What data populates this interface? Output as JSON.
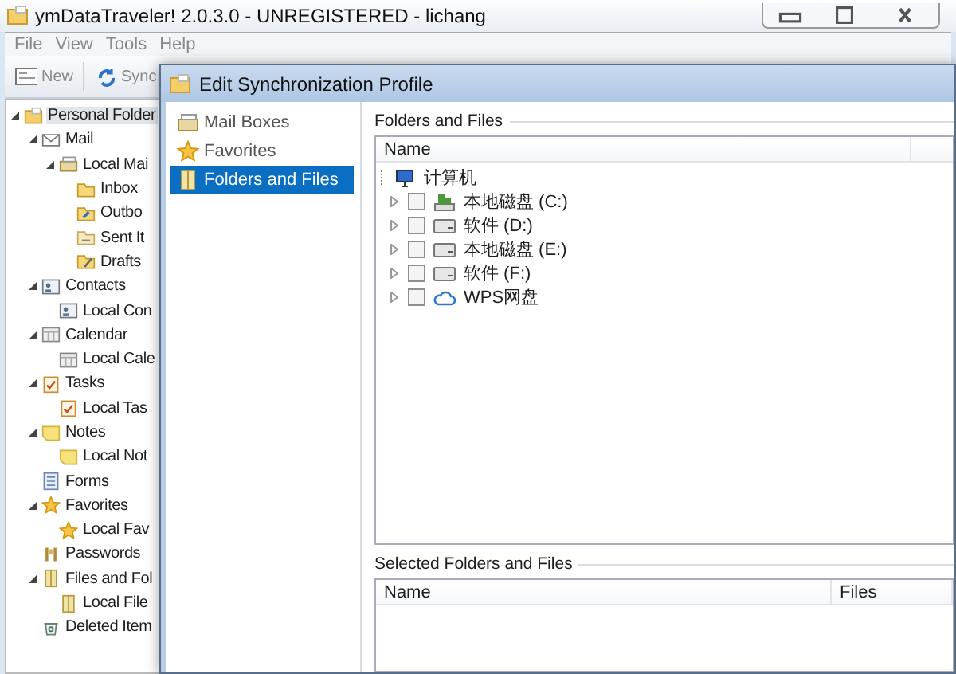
{
  "window": {
    "title": "ymDataTraveler! 2.0.3.0 - UNREGISTERED - lichang"
  },
  "menu": [
    "File",
    "View",
    "Tools",
    "Help"
  ],
  "toolbar": [
    {
      "label": "New",
      "kind": "new"
    },
    {
      "label": "Sync",
      "kind": "sync"
    }
  ],
  "tree": {
    "items": [
      {
        "label": "Personal Folder",
        "kind": "root",
        "expanded": true,
        "selected": true,
        "children": [
          {
            "label": "Mail",
            "kind": "mail",
            "expanded": true,
            "selected": false,
            "children": [
              {
                "label": "Local Mai",
                "kind": "mailbox",
                "expanded": true,
                "selected": false,
                "children": [
                  {
                    "label": "Inbox",
                    "kind": "folder",
                    "selected": false
                  },
                  {
                    "label": "Outbo",
                    "kind": "outbox",
                    "selected": false
                  },
                  {
                    "label": "Sent It",
                    "kind": "sent",
                    "selected": false
                  },
                  {
                    "label": "Drafts",
                    "kind": "drafts",
                    "selected": false
                  }
                ]
              }
            ]
          },
          {
            "label": "Contacts",
            "kind": "contacts",
            "expanded": true,
            "selected": false,
            "children": [
              {
                "label": "Local Con",
                "kind": "contacts",
                "selected": false
              }
            ]
          },
          {
            "label": "Calendar",
            "kind": "calendar",
            "expanded": true,
            "selected": false,
            "children": [
              {
                "label": "Local Cale",
                "kind": "calendar",
                "selected": false
              }
            ]
          },
          {
            "label": "Tasks",
            "kind": "tasks",
            "expanded": true,
            "selected": false,
            "children": [
              {
                "label": "Local Tas",
                "kind": "tasks",
                "selected": false
              }
            ]
          },
          {
            "label": "Notes",
            "kind": "notes",
            "expanded": true,
            "selected": false,
            "children": [
              {
                "label": "Local Not",
                "kind": "notes",
                "selected": false
              }
            ]
          },
          {
            "label": "Forms",
            "kind": "forms",
            "selected": false
          },
          {
            "label": "Favorites",
            "kind": "favorites",
            "expanded": true,
            "selected": false,
            "children": [
              {
                "label": "Local Fav",
                "kind": "favorites",
                "selected": false
              }
            ]
          },
          {
            "label": "Passwords",
            "kind": "passwords",
            "selected": false
          },
          {
            "label": "Files and Fol",
            "kind": "files",
            "expanded": true,
            "selected": false,
            "children": [
              {
                "label": "Local File",
                "kind": "files",
                "selected": false
              }
            ]
          },
          {
            "label": "Deleted Item",
            "kind": "deleted",
            "selected": false
          }
        ]
      }
    ]
  },
  "dialog": {
    "title": "Edit Synchronization Profile",
    "nav": [
      {
        "label": "Mail Boxes",
        "kind": "mailbox",
        "selected": false
      },
      {
        "label": "Favorites",
        "kind": "favorites",
        "selected": false
      },
      {
        "label": "Folders and Files",
        "kind": "files",
        "selected": true
      }
    ],
    "folders": {
      "title": "Folders and Files",
      "columns": [
        "Name"
      ],
      "root": {
        "label": "计算机",
        "expanded": true,
        "children": [
          {
            "label": "本地磁盘 (C:)",
            "kind": "system-drive",
            "checked": false,
            "expanded": false
          },
          {
            "label": "软件 (D:)",
            "kind": "drive",
            "checked": false,
            "expanded": false
          },
          {
            "label": "本地磁盘 (E:)",
            "kind": "drive",
            "checked": false,
            "expanded": false
          },
          {
            "label": "软件 (F:)",
            "kind": "drive",
            "checked": false,
            "expanded": false
          },
          {
            "label": "WPS网盘",
            "kind": "cloud",
            "checked": false,
            "expanded": false
          }
        ]
      }
    },
    "selected": {
      "title": "Selected Folders and Files",
      "columns": [
        "Name",
        "Files"
      ]
    }
  }
}
